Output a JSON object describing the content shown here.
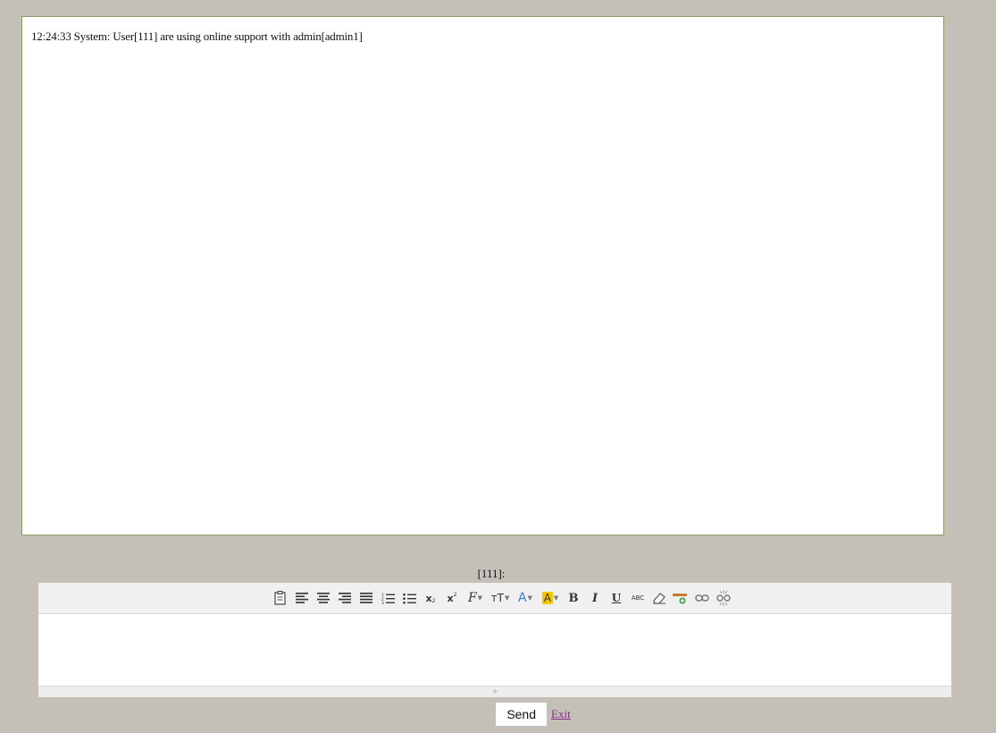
{
  "chat": {
    "messages": [
      "12:24:33 System: User[111] are using online support with admin[admin1]"
    ]
  },
  "compose": {
    "label": "[111]:"
  },
  "toolbar": {
    "buttons": [
      "paste-icon",
      "align-left-icon",
      "align-center-icon",
      "align-right-icon",
      "align-justify-icon",
      "ordered-list-icon",
      "unordered-list-icon",
      "subscript-icon",
      "superscript-icon",
      "font-family-icon",
      "font-size-icon",
      "font-color-icon",
      "highlight-color-icon",
      "bold-icon",
      "italic-icon",
      "underline-icon",
      "strikethrough-icon",
      "eraser-icon",
      "insert-row-icon",
      "link-icon",
      "unlink-icon"
    ],
    "subscript_glyph": "x",
    "superscript_glyph": "x",
    "font_family_glyph": "F",
    "font_size_glyph": "тT",
    "font_color_glyph": "A",
    "highlight_glyph": "A",
    "bold_glyph": "B",
    "italic_glyph": "I",
    "underline_glyph": "U",
    "strike_glyph": "ABC",
    "highlight_color": "#f7c600",
    "font_color_color": "#3a7bd5"
  },
  "editor": {
    "resize_glyph": "÷"
  },
  "actions": {
    "send_label": "Send",
    "exit_label": "Exit"
  }
}
